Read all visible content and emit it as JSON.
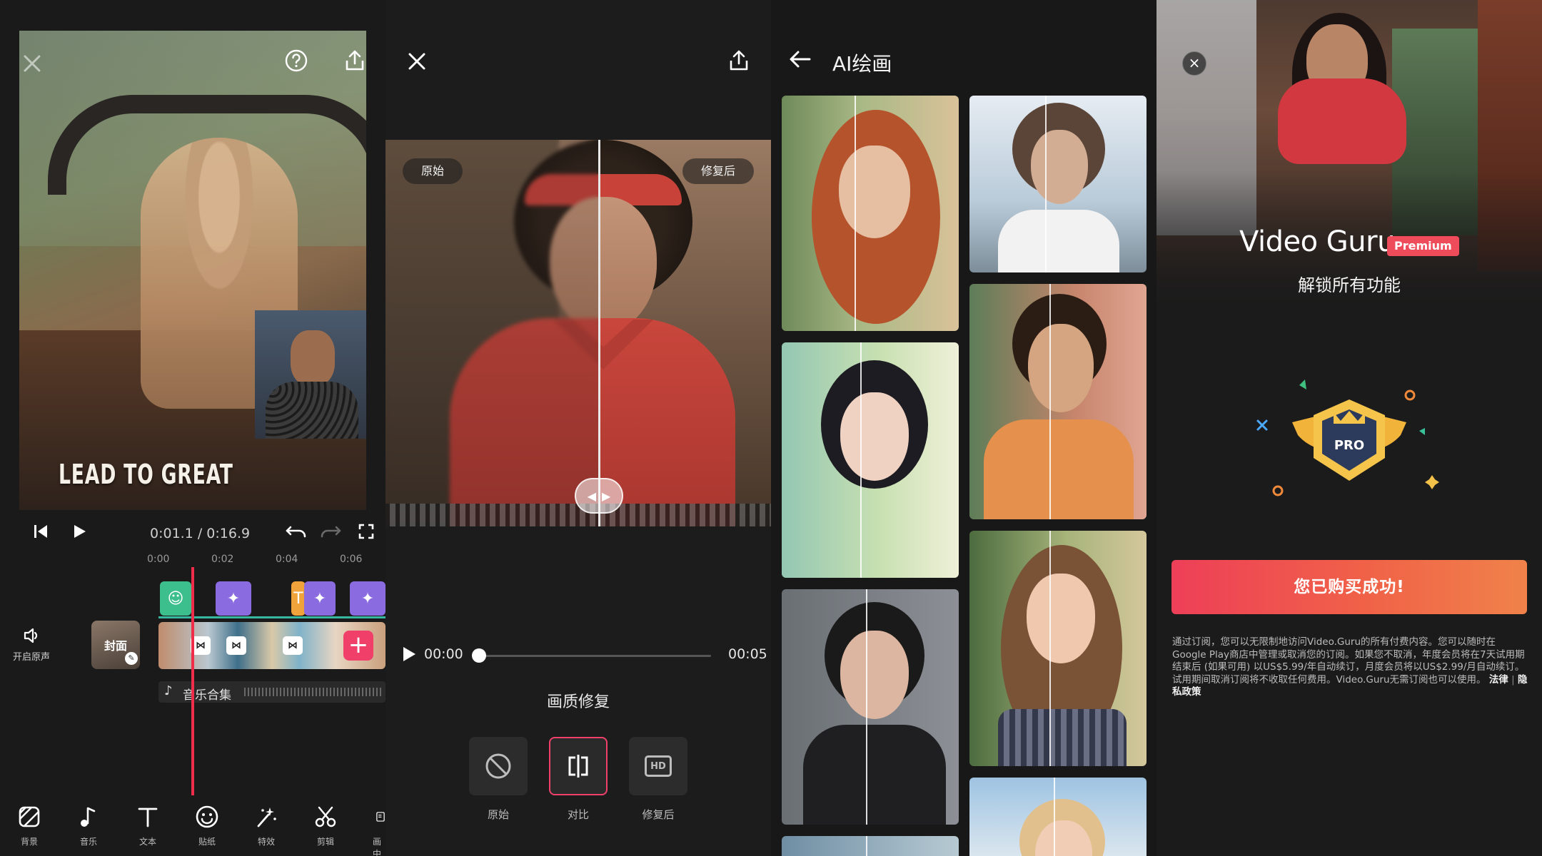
{
  "editor": {
    "caption": "LEAD TO GREAT",
    "time": "0:01.1 / 0:16.9",
    "ruler": [
      "0:00",
      "0:02",
      "0:04",
      "0:06"
    ],
    "sound_label": "开启原声",
    "cover_label": "封面",
    "music_label": "音乐合集",
    "tools": [
      {
        "icon": "background-icon",
        "label": "背景"
      },
      {
        "icon": "music-icon",
        "label": "音乐"
      },
      {
        "icon": "text-icon",
        "label": "文本"
      },
      {
        "icon": "sticker-icon",
        "label": "贴纸"
      },
      {
        "icon": "effects-icon",
        "label": "特效"
      },
      {
        "icon": "cut-icon",
        "label": "剪辑"
      },
      {
        "icon": "pip-icon",
        "label": "画中"
      }
    ]
  },
  "repair": {
    "tag_before": "原始",
    "tag_after": "修复后",
    "time_current": "00:00",
    "time_total": "00:05",
    "progress": 0,
    "title": "画质修复",
    "modes": [
      {
        "icon": "original-icon",
        "label": "原始",
        "active": false
      },
      {
        "icon": "compare-icon",
        "label": "对比",
        "active": true
      },
      {
        "icon": "hd-icon",
        "label": "修复后",
        "active": false
      }
    ],
    "hd_badge": "HD"
  },
  "ai_painting": {
    "title": "AI绘画"
  },
  "premium": {
    "brand": "Video Guru",
    "badge": "Premium",
    "unlock": "解锁所有功能",
    "emblem_label": "PRO",
    "cta": "您已购买成功!",
    "terms": "通过订阅，您可以无限制地访问Video.Guru的所有付费内容。您可以随时在Google Play商店中管理或取消您的订阅。如果您不取消，年度会员将在7天试用期结束后 (如果可用) 以US$5.99/年自动续订，月度会员将以US$2.99/月自动续订。试用期间取消订阅将不收取任何费用。Video.Guru无需订阅也可以使用。",
    "link_legal": "法律",
    "link_privacy": "隐私政策"
  },
  "colors": {
    "accent": "#f0406a",
    "playhead": "#ef2d4b",
    "cta_start": "#ee3f58",
    "cta_end": "#f0824a"
  }
}
